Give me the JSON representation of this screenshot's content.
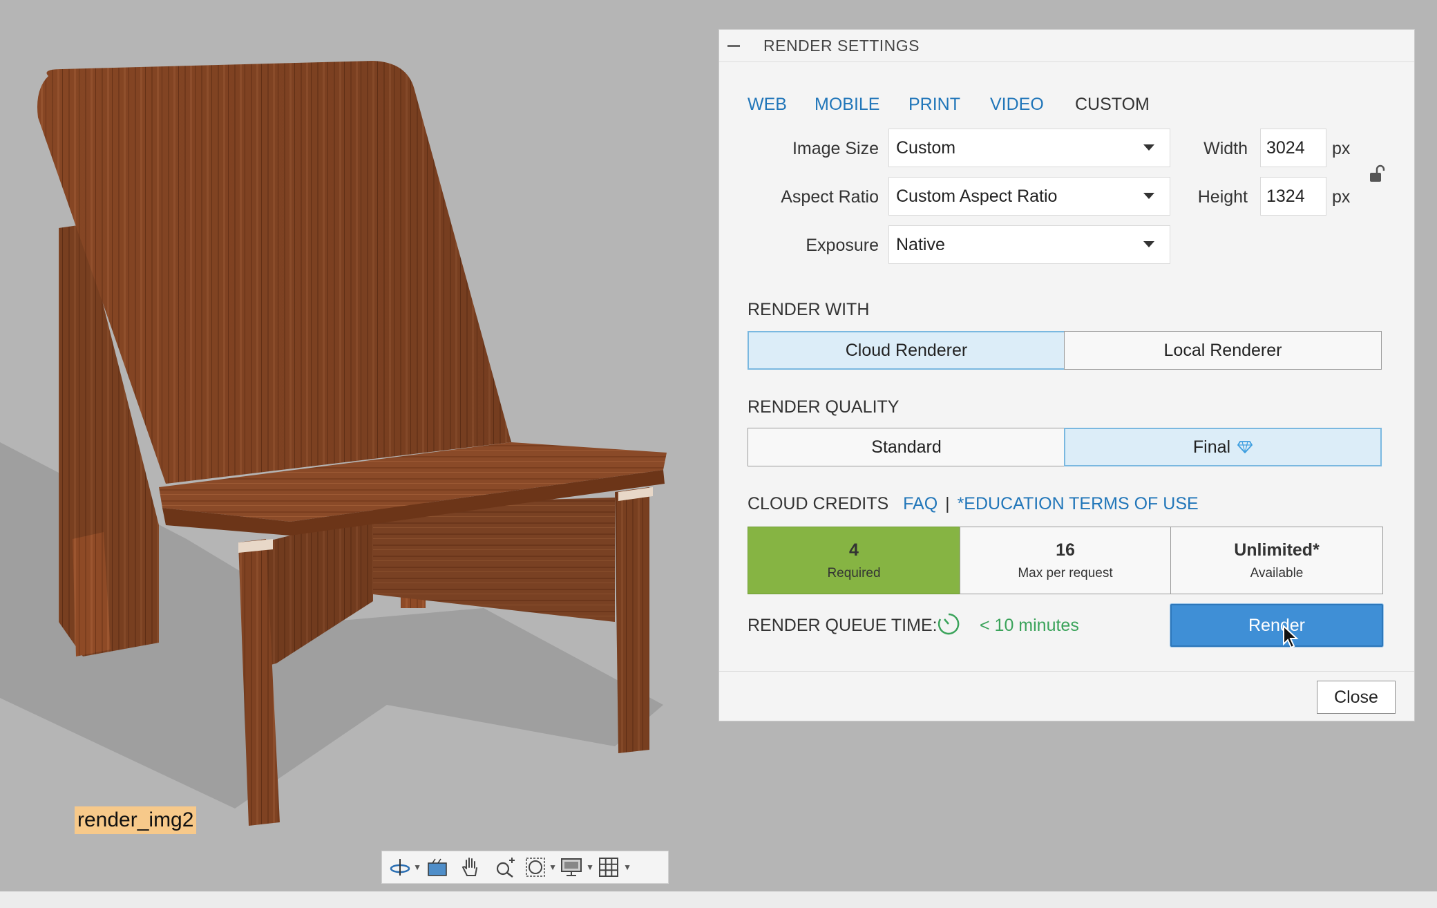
{
  "viewport": {
    "render_label": "render_img2"
  },
  "toolbar": {
    "buttons": [
      {
        "icon": "orbit-icon"
      },
      {
        "icon": "look-at-icon"
      },
      {
        "icon": "pan-hand-icon"
      },
      {
        "icon": "zoom-icon"
      },
      {
        "icon": "fit-window-icon"
      },
      {
        "icon": "display-settings-icon"
      },
      {
        "icon": "grid-icon"
      }
    ]
  },
  "panel": {
    "title": "RENDER SETTINGS",
    "tabs": [
      {
        "label": "WEB"
      },
      {
        "label": "MOBILE"
      },
      {
        "label": "PRINT"
      },
      {
        "label": "VIDEO"
      },
      {
        "label": "CUSTOM",
        "active": true
      }
    ],
    "image_size": {
      "label": "Image Size",
      "value": "Custom"
    },
    "aspect_ratio": {
      "label": "Aspect Ratio",
      "value": "Custom Aspect Ratio"
    },
    "exposure": {
      "label": "Exposure",
      "value": "Native"
    },
    "width": {
      "label": "Width",
      "value": "3024",
      "unit": "px"
    },
    "height": {
      "label": "Height",
      "value": "1324",
      "unit": "px"
    },
    "render_with": {
      "label": "RENDER WITH",
      "options": [
        "Cloud Renderer",
        "Local Renderer"
      ],
      "selected": "Cloud Renderer"
    },
    "render_quality": {
      "label": "RENDER QUALITY",
      "options": [
        "Standard",
        "Final"
      ],
      "selected": "Final"
    },
    "cloud_credits": {
      "label": "CLOUD CREDITS",
      "faq_link": "FAQ",
      "separator": "|",
      "terms_link": "*EDUCATION TERMS OF USE",
      "boxes": [
        {
          "value": "4",
          "caption": "Required"
        },
        {
          "value": "16",
          "caption": "Max per request"
        },
        {
          "value": "Unlimited*",
          "caption": "Available"
        }
      ]
    },
    "queue": {
      "label": "RENDER QUEUE TIME:",
      "time": "< 10 minutes"
    },
    "render_button": "Render",
    "close_button": "Close"
  },
  "colors": {
    "accent_blue": "#3f8fd6",
    "link_blue": "#2176b9",
    "required_green": "#86b443",
    "queue_green": "#3aa35a"
  }
}
